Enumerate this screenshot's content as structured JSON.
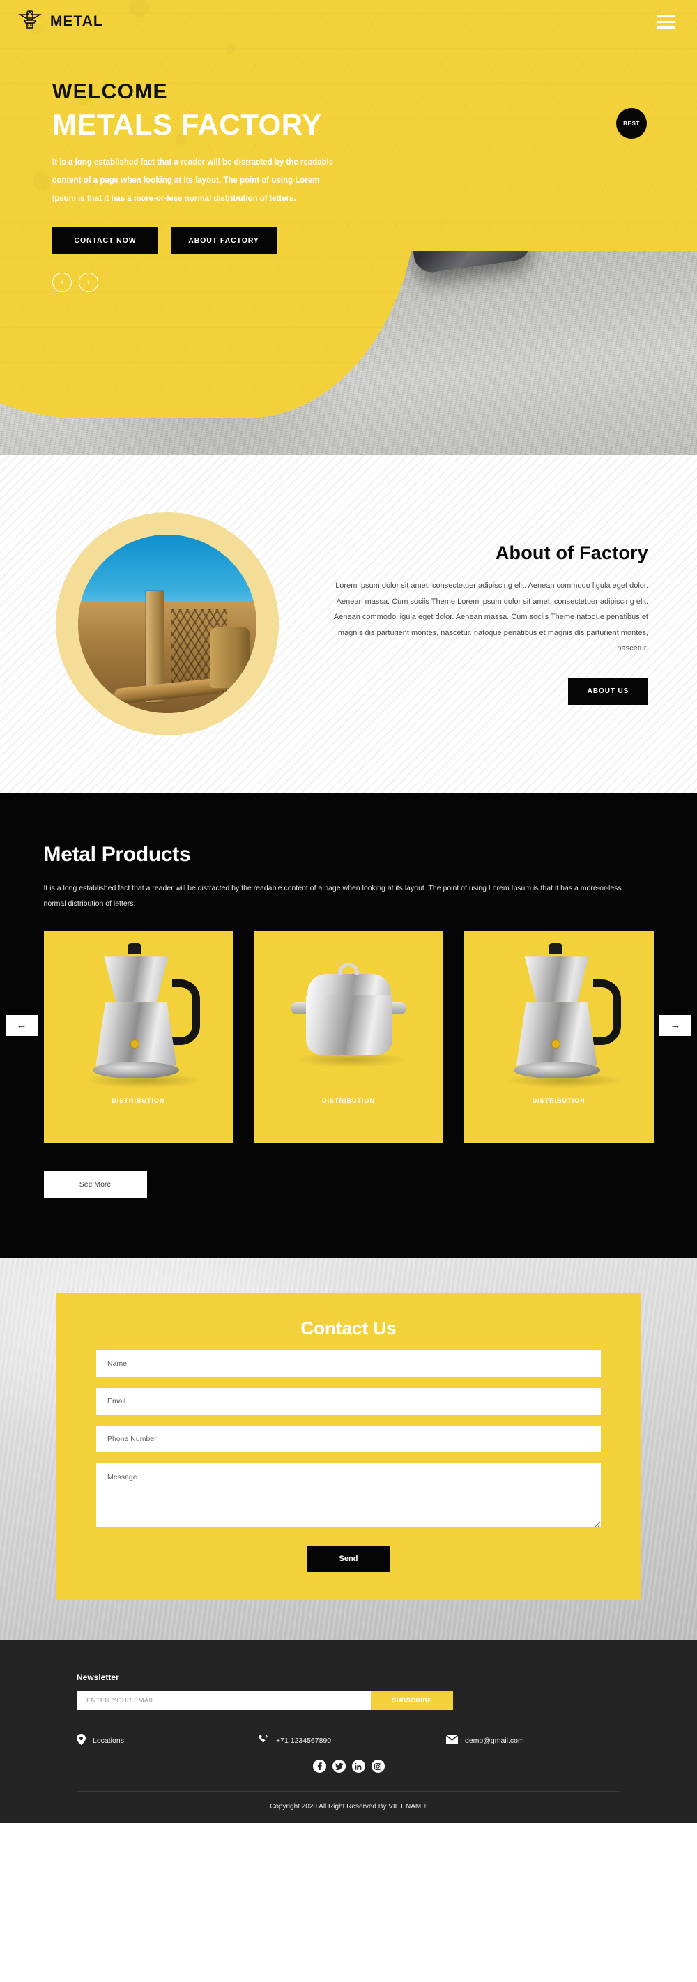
{
  "brand": {
    "name": "METAL",
    "logo_icon": "metal-logo-icon"
  },
  "nav": {
    "menu_icon": "hamburger-menu-icon"
  },
  "hero": {
    "eyebrow": "WELCOME",
    "title": "METALS FACTORY",
    "paragraph": "It is a long established fact that a reader will be distracted by the readable content of a page when looking at its layout. The point of using Lorem Ipsum is that it has a more-or-less normal distribution of letters.",
    "primary_button": "CONTACT NOW",
    "secondary_button": "ABOUT FACTORY",
    "prev_icon": "chevron-left-icon",
    "next_icon": "chevron-right-icon",
    "badge": "BEST",
    "accent_color": "#f2d13b"
  },
  "about": {
    "title": "About of Factory",
    "paragraph": "Lorem ipsum dolor sit amet, consectetuer adipiscing elit. Aenean commodo ligula eget dolor. Aenean massa. Cum sociis Theme Lorem ipsum dolor sit amet, consectetuer adipiscing elit. Aenean commodo ligula eget dolor. Aenean massa. Cum sociis Theme natoque penatibus et magnis dis parturient montes, nascetur. natoque penatibus et magnis dis parturient montes, nascetur.",
    "button": "ABOUT US",
    "image_alt": "steel-factory-photo"
  },
  "products": {
    "title": "Metal Products",
    "paragraph": "It is a long established fact that a reader will be distracted by the readable content of a page when looking at its layout. The point of using Lorem Ipsum is that it has a more-or-less normal distribution of letters.",
    "prev_icon": "arrow-left-icon",
    "next_icon": "arrow-right-icon",
    "see_more": "See More",
    "cards": [
      {
        "label": "DISTRIBUTION",
        "image": "moka-pot"
      },
      {
        "label": "DISTRIBUTION",
        "image": "cooking-pot"
      },
      {
        "label": "DISTRIBUTION",
        "image": "moka-pot"
      }
    ]
  },
  "contact": {
    "title": "Contact Us",
    "name_placeholder": "Name",
    "email_placeholder": "Email",
    "phone_placeholder": "Phone Number",
    "message_placeholder": "Message",
    "name_value": "",
    "email_value": "",
    "phone_value": "",
    "message_value": "",
    "send_button": "Send"
  },
  "footer": {
    "newsletter_label": "Newsletter",
    "newsletter_placeholder": "ENTER YOUR EMAIL",
    "newsletter_value": "",
    "subscribe_button": "SUBSCRIBE",
    "location_text": "Locations",
    "phone_text": "+71 1234567890",
    "email_text": "demo@gmail.com",
    "location_icon": "map-pin-icon",
    "phone_icon": "phone-ringing-icon",
    "email_icon": "envelope-icon",
    "socials": [
      {
        "name": "facebook-icon",
        "glyph": "f"
      },
      {
        "name": "twitter-icon",
        "glyph": "t"
      },
      {
        "name": "linkedin-icon",
        "glyph": "in"
      },
      {
        "name": "instagram-icon",
        "glyph": "ig"
      }
    ],
    "copyright": "Copyright 2020 All Right Reserved By VIET NAM +"
  }
}
